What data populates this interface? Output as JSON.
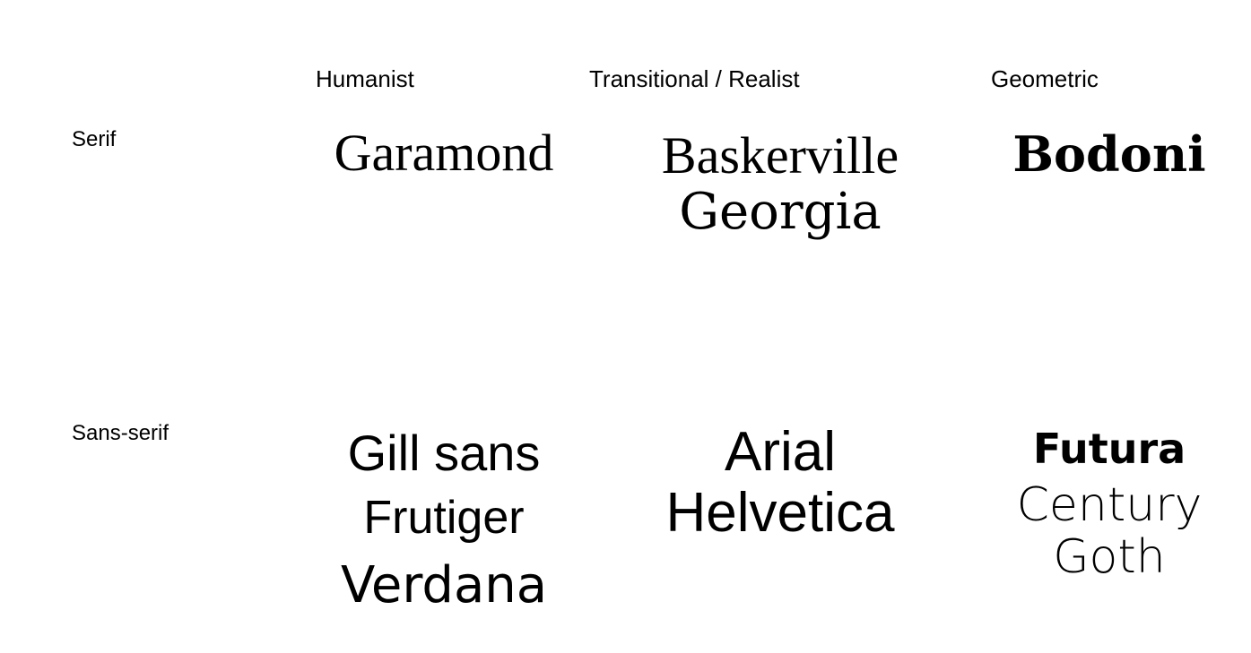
{
  "columns": {
    "humanist": "Humanist",
    "transitional": "Transitional / Realist",
    "geometric": "Geometric"
  },
  "rows": {
    "serif": "Serif",
    "sans": "Sans-serif"
  },
  "cells": {
    "serif_humanist": [
      "Garamond"
    ],
    "serif_transitional": [
      "Baskerville",
      "Georgia"
    ],
    "serif_geometric": [
      "Bodoni"
    ],
    "sans_humanist": [
      "Gill sans",
      "Frutiger",
      "Verdana"
    ],
    "sans_transitional": [
      "Arial",
      "Helvetica"
    ],
    "sans_geometric": [
      "Futura",
      "Century",
      "Goth"
    ]
  }
}
